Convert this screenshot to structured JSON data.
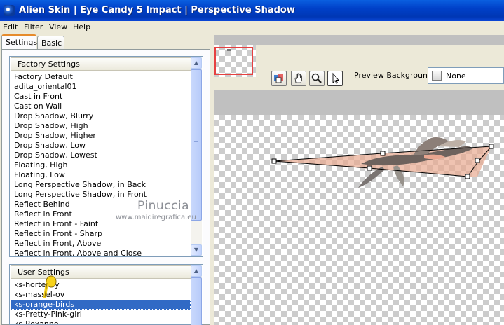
{
  "window": {
    "title": "Alien Skin | Eye Candy 5 Impact | Perspective Shadow"
  },
  "menu": [
    "Edit",
    "Filter",
    "View",
    "Help"
  ],
  "tabs": {
    "settings": "Settings",
    "basic": "Basic"
  },
  "factory_settings": {
    "header": "Factory Settings",
    "items": [
      "Factory Default",
      "adita_oriental01",
      "Cast in Front",
      "Cast on Wall",
      "Drop Shadow, Blurry",
      "Drop Shadow, High",
      "Drop Shadow, Higher",
      "Drop Shadow, Low",
      "Drop Shadow, Lowest",
      "Floating, High",
      "Floating, Low",
      "Long Perspective Shadow, in Back",
      "Long Perspective Shadow, in Front",
      "Reflect Behind",
      "Reflect in Front",
      "Reflect in Front - Faint",
      "Reflect in Front - Sharp",
      "Reflect in Front, Above",
      "Reflect in Front, Above and Close"
    ]
  },
  "user_settings": {
    "header": "User Settings",
    "items": [
      "ks-hortensy",
      "ks-massel-ov",
      "ks-orange-birds",
      "ks-Pretty-Pink-girl",
      "ks-Roxanne"
    ],
    "selected_index": 2
  },
  "watermark": {
    "line1": "Pinuccia",
    "line2": "www.maidiregrafica.eu"
  },
  "preview_background": {
    "label": "Preview Background:",
    "value": "None"
  },
  "tools": [
    "preview-toggle-icon",
    "hand-icon",
    "zoom-icon",
    "pointer-icon"
  ],
  "colors": {
    "titlebar": "#0040c8",
    "selection": "#316ac5",
    "accent_tab": "#e68b2c",
    "navigator_frame": "#e64040"
  }
}
